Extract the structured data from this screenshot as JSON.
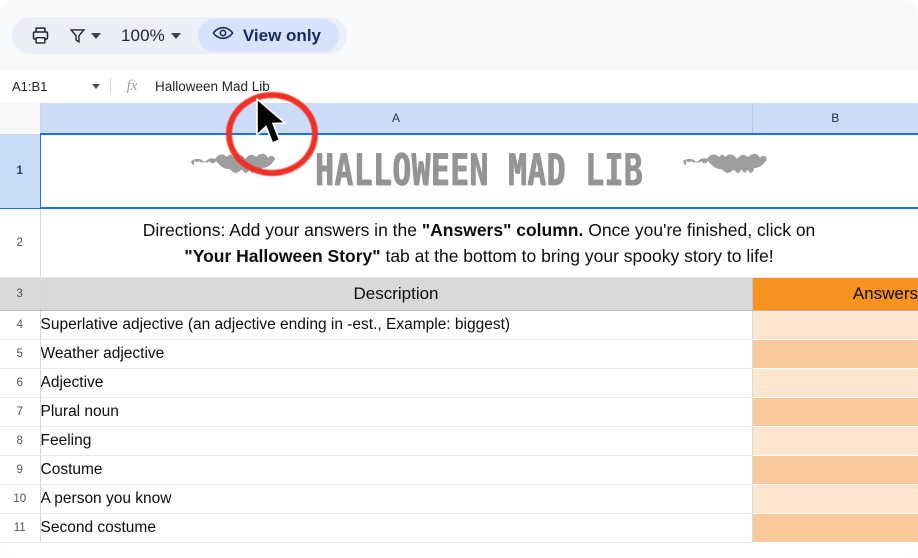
{
  "toolbar": {
    "print_icon": "print-icon",
    "filter_icon": "filter-icon",
    "zoom_value": "100%",
    "view_only_label": "View only",
    "eye_icon": "eye-icon"
  },
  "formula_bar": {
    "name_box_value": "A1:B1",
    "fx_label": "fx",
    "formula_value": "Halloween Mad Lib"
  },
  "grid": {
    "columns": [
      "A",
      "B"
    ],
    "row_numbers": [
      "1",
      "2",
      "3",
      "4",
      "5",
      "6",
      "7",
      "8",
      "9",
      "10",
      "11"
    ],
    "title_row": {
      "text": "Halloween Mad Lib",
      "left_bat_icon": "bat-icon",
      "right_bat_icon": "bat-icon",
      "title_color": "#949494"
    },
    "directions_row": {
      "line1_part1": "Directions: Add your answers in the ",
      "line1_bold": "\"Answers\" column.",
      "line1_part2": " Once you're finished, click on",
      "line2_bold": "\"Your Halloween Story\"",
      "line2_part": " tab at the bottom to bring your spooky story to life!"
    },
    "headers": {
      "description": "Description",
      "answers": "Answers",
      "description_bg": "#D9D9D9",
      "answers_bg": "#F7931E"
    },
    "rows": [
      {
        "num": "4",
        "description": "Superlative adjective (an adjective ending in -est., Example: biggest)",
        "answer": "",
        "band": "light"
      },
      {
        "num": "5",
        "description": "Weather adjective",
        "answer": "",
        "band": "dark"
      },
      {
        "num": "6",
        "description": "Adjective",
        "answer": "",
        "band": "light"
      },
      {
        "num": "7",
        "description": "Plural noun",
        "answer": "",
        "band": "dark"
      },
      {
        "num": "8",
        "description": "Feeling",
        "answer": "",
        "band": "light"
      },
      {
        "num": "9",
        "description": "Costume",
        "answer": "",
        "band": "dark"
      },
      {
        "num": "10",
        "description": "A person you know",
        "answer": "",
        "band": "light"
      },
      {
        "num": "11",
        "description": "Second costume",
        "answer": "",
        "band": "dark"
      }
    ],
    "answer_band_light": "#FCE4CF",
    "answer_band_dark": "#F7C99B"
  },
  "annotation": {
    "circle_color": "#EE3124",
    "circle_name": "highlight-circle",
    "cursor_name": "mouse-cursor"
  }
}
